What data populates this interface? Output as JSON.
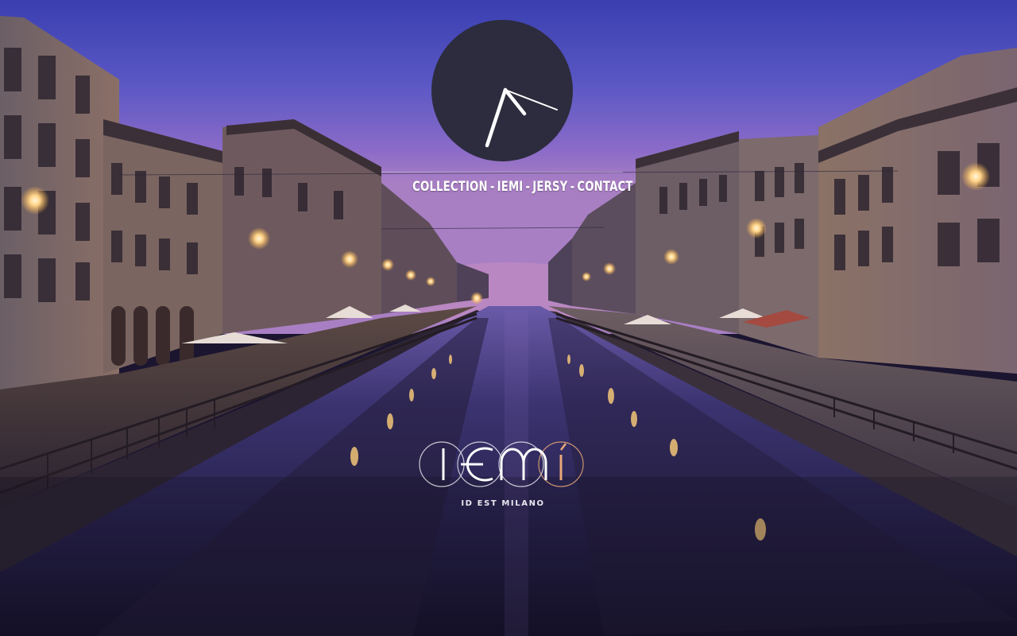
{
  "site": {
    "logo_icon": "clock-icon",
    "colors": {
      "clock_face": "#2c2c3e",
      "clock_hands": "#ffffff",
      "brand_ring": "#ffffff",
      "brand_accent": "#e8a878"
    }
  },
  "nav": {
    "items": [
      {
        "label": "COLLECTION"
      },
      {
        "label": "IEMI"
      },
      {
        "label": "JERSY"
      },
      {
        "label": "CONTACT"
      }
    ],
    "separator": "-"
  },
  "brand": {
    "wordmark": "IEMI",
    "tagline": "ID EST MILANO"
  }
}
